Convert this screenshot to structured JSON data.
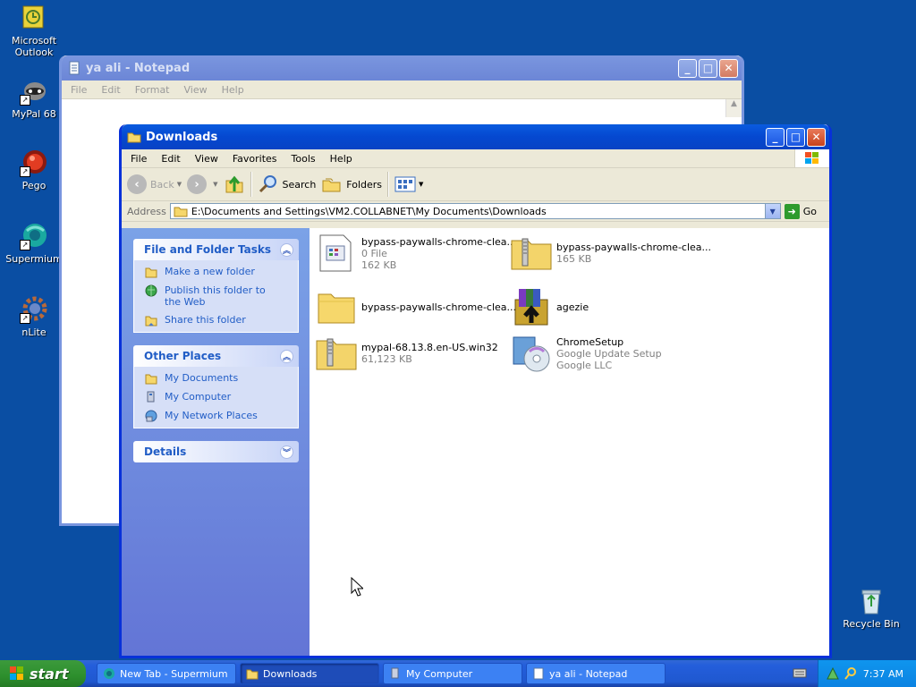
{
  "desktop": {
    "icons": [
      {
        "label": "Microsoft Outlook"
      },
      {
        "label": "MyPal 68"
      },
      {
        "label": "Pego"
      },
      {
        "label": "Supermium"
      },
      {
        "label": "nLite"
      },
      {
        "label": "Recycle Bin"
      }
    ]
  },
  "notepad": {
    "title": "ya ali - Notepad",
    "menu": [
      "File",
      "Edit",
      "Format",
      "View",
      "Help"
    ]
  },
  "explorer": {
    "title": "Downloads",
    "menu": [
      "File",
      "Edit",
      "View",
      "Favorites",
      "Tools",
      "Help"
    ],
    "toolbar": {
      "back": "Back",
      "search": "Search",
      "folders": "Folders"
    },
    "address": {
      "label": "Address",
      "value": "E:\\Documents and Settings\\VM2.COLLABNET\\My Documents\\Downloads",
      "go": "Go"
    },
    "tasks": {
      "title": "File and Folder Tasks",
      "items": [
        "Make a new folder",
        "Publish this folder to the Web",
        "Share this folder"
      ]
    },
    "places": {
      "title": "Other Places",
      "items": [
        "My Documents",
        "My Computer",
        "My Network Places"
      ]
    },
    "details": {
      "title": "Details"
    },
    "files": [
      {
        "name": "bypass-paywalls-chrome-clea...",
        "line2": "0 File",
        "line3": "162 KB",
        "icon": "blank-file-icon"
      },
      {
        "name": "bypass-paywalls-chrome-clea...",
        "line2": "165 KB",
        "line3": "",
        "icon": "zip-folder-icon"
      },
      {
        "name": "bypass-paywalls-chrome-clea...",
        "line2": "",
        "line3": "",
        "icon": "folder-icon"
      },
      {
        "name": "agezie",
        "line2": "",
        "line3": "",
        "icon": "winrar-icon"
      },
      {
        "name": "mypal-68.13.8.en-US.win32",
        "line2": "61,123 KB",
        "line3": "",
        "icon": "zip-folder-icon"
      },
      {
        "name": "ChromeSetup",
        "line2": "Google Update Setup",
        "line3": "Google LLC",
        "icon": "setup-cd-icon"
      }
    ]
  },
  "taskbar": {
    "start": "start",
    "tasks": [
      {
        "label": "New Tab - Supermium"
      },
      {
        "label": "Downloads"
      },
      {
        "label": "My Computer"
      },
      {
        "label": "ya ali - Notepad"
      }
    ],
    "clock": "7:37 AM"
  }
}
